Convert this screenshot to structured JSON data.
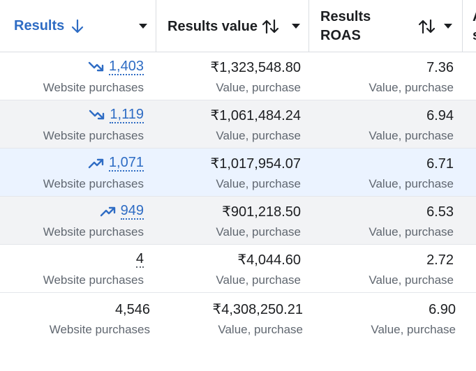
{
  "header": {
    "results": "Results",
    "results_value": "Results value",
    "roas_line1": "Results",
    "roas_line2": "ROAS",
    "cut_top": "A",
    "cut_bottom": "s"
  },
  "rows": [
    {
      "results": "1,403",
      "results_sub": "Website purchases",
      "value": "₹1,323,548.80",
      "value_sub": "Value, purchase",
      "roas": "7.36",
      "roas_sub": "Value, purchase",
      "trend": "down",
      "bg": "#ffffff"
    },
    {
      "results": "1,119",
      "results_sub": "Website purchases",
      "value": "₹1,061,484.24",
      "value_sub": "Value, purchase",
      "roas": "6.94",
      "roas_sub": "Value, purchase",
      "trend": "down",
      "bg": "#f2f3f5"
    },
    {
      "results": "1,071",
      "results_sub": "Website purchases",
      "value": "₹1,017,954.07",
      "value_sub": "Value, purchase",
      "roas": "6.71",
      "roas_sub": "Value, purchase",
      "trend": "up",
      "bg": "#ebf3ff"
    },
    {
      "results": "949",
      "results_sub": "Website purchases",
      "value": "₹901,218.50",
      "value_sub": "Value, purchase",
      "roas": "6.53",
      "roas_sub": "Value, purchase",
      "trend": "up",
      "bg": "#f2f3f5"
    },
    {
      "results": "4",
      "results_sub": "Website purchases",
      "value": "₹4,044.60",
      "value_sub": "Value, purchase",
      "roas": "2.72",
      "roas_sub": "Value, purchase",
      "trend": "none",
      "bg": "#ffffff"
    }
  ],
  "total": {
    "results": "4,546",
    "results_sub": "Website purchases",
    "value": "₹4,308,250.21",
    "value_sub": "Value, purchase",
    "roas": "6.90",
    "roas_sub": "Value, purchase"
  },
  "colors": {
    "accent": "#2e6cc4",
    "hover_row": "#ebf3ff",
    "alt_row": "#f2f3f5"
  }
}
